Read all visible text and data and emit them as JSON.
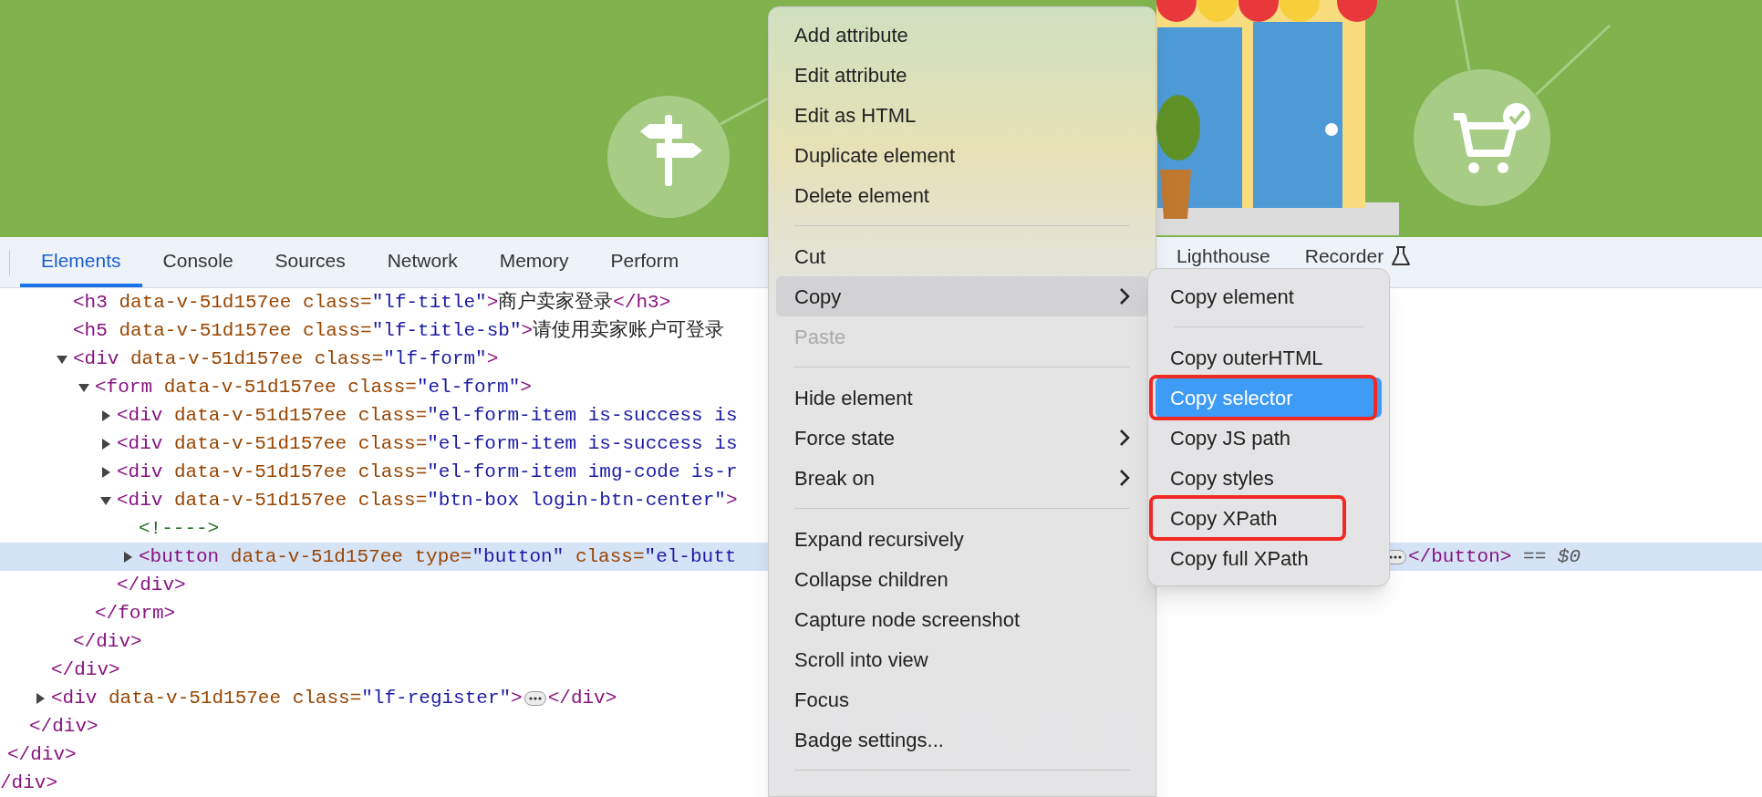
{
  "tabs": [
    {
      "label": "Elements",
      "selected": true
    },
    {
      "label": "Console",
      "selected": false
    },
    {
      "label": "Sources",
      "selected": false
    },
    {
      "label": "Network",
      "selected": false
    },
    {
      "label": "Memory",
      "selected": false
    },
    {
      "label": "Perform",
      "selected": false
    }
  ],
  "tabs_after_menu": [
    {
      "label": "Lighthouse",
      "experimental": false
    },
    {
      "label": "Recorder",
      "experimental": true
    }
  ],
  "dom_tree": [
    {
      "close": [
        {
          "kind": "tag",
          "text": "/div>"
        }
      ],
      "children": [
        {
          "close": [
            {
              "kind": "tag",
              "text": "</div>"
            }
          ],
          "children": [
            {
              "close": [
                {
                  "kind": "tag",
                  "text": "</div>"
                }
              ],
              "children": [
                {
                  "close": [
                    {
                      "kind": "tag",
                      "text": "</div>"
                    }
                  ],
                  "children": [
                    {
                      "selected": false,
                      "line": [
                        {
                          "kind": "tag",
                          "text": "<h3 "
                        },
                        {
                          "kind": "attr",
                          "text": "data-v-51d157ee class="
                        },
                        {
                          "kind": "value",
                          "text": "\"lf-title\""
                        },
                        {
                          "kind": "tag",
                          "text": ">"
                        },
                        {
                          "kind": "text",
                          "text": "商户卖家登录"
                        },
                        {
                          "kind": "tag",
                          "text": "</h3>"
                        }
                      ]
                    },
                    {
                      "selected": false,
                      "line": [
                        {
                          "kind": "tag",
                          "text": "<h5 "
                        },
                        {
                          "kind": "attr",
                          "text": "data-v-51d157ee class="
                        },
                        {
                          "kind": "value",
                          "text": "\"lf-title-sb\""
                        },
                        {
                          "kind": "tag",
                          "text": ">"
                        },
                        {
                          "kind": "text",
                          "text": "请使用卖家账户可登录"
                        }
                      ]
                    },
                    {
                      "selected": false,
                      "expanded": true,
                      "line": [
                        {
                          "kind": "tag",
                          "text": "<div "
                        },
                        {
                          "kind": "attr",
                          "text": "data-v-51d157ee class="
                        },
                        {
                          "kind": "value",
                          "text": "\"lf-form\""
                        },
                        {
                          "kind": "tag",
                          "text": ">"
                        }
                      ],
                      "close": [
                        {
                          "kind": "tag",
                          "text": "</div>"
                        }
                      ],
                      "children": [
                        {
                          "selected": false,
                          "expanded": true,
                          "line": [
                            {
                              "kind": "tag",
                              "text": "<form "
                            },
                            {
                              "kind": "attr",
                              "text": "data-v-51d157ee class="
                            },
                            {
                              "kind": "value",
                              "text": "\"el-form\""
                            },
                            {
                              "kind": "tag",
                              "text": ">"
                            }
                          ],
                          "close": [
                            {
                              "kind": "tag",
                              "text": "</form>"
                            }
                          ],
                          "children": [
                            {
                              "selected": false,
                              "expanded": false,
                              "line": [
                                {
                                  "kind": "tag",
                                  "text": "<div "
                                },
                                {
                                  "kind": "attr",
                                  "text": "data-v-51d157ee class="
                                },
                                {
                                  "kind": "value",
                                  "text": "\"el-form-item is-success is"
                                }
                              ]
                            },
                            {
                              "selected": false,
                              "expanded": false,
                              "line": [
                                {
                                  "kind": "tag",
                                  "text": "<div "
                                },
                                {
                                  "kind": "attr",
                                  "text": "data-v-51d157ee class="
                                },
                                {
                                  "kind": "value",
                                  "text": "\"el-form-item is-success is"
                                }
                              ]
                            },
                            {
                              "selected": false,
                              "expanded": false,
                              "line": [
                                {
                                  "kind": "tag",
                                  "text": "<div "
                                },
                                {
                                  "kind": "attr",
                                  "text": "data-v-51d157ee class="
                                },
                                {
                                  "kind": "value",
                                  "text": "\"el-form-item img-code is-r"
                                }
                              ]
                            },
                            {
                              "selected": false,
                              "expanded": true,
                              "line": [
                                {
                                  "kind": "tag",
                                  "text": "<div "
                                },
                                {
                                  "kind": "attr",
                                  "text": "data-v-51d157ee class="
                                },
                                {
                                  "kind": "value",
                                  "text": "\"btn-box login-btn-center\""
                                },
                                {
                                  "kind": "tag",
                                  "text": ">"
                                }
                              ],
                              "close": [
                                {
                                  "kind": "tag",
                                  "text": "</div>"
                                }
                              ],
                              "children": [
                                {
                                  "selected": false,
                                  "line": [
                                    {
                                      "kind": "comment",
                                      "text": "<!---->"
                                    }
                                  ]
                                },
                                {
                                  "selected": true,
                                  "expanded": false,
                                  "covered": true,
                                  "badge": true,
                                  "line": [
                                    {
                                      "kind": "tag",
                                      "text": "<button "
                                    },
                                    {
                                      "kind": "attr",
                                      "text": "data-v-51d157ee type="
                                    },
                                    {
                                      "kind": "value",
                                      "text": "\"button\""
                                    },
                                    {
                                      "kind": "attr",
                                      "text": " class="
                                    },
                                    {
                                      "kind": "value",
                                      "text": "\"el-butt"
                                    }
                                  ],
                                  "after": [
                                    {
                                      "kind": "tag",
                                      "text": "</button>"
                                    },
                                    {
                                      "kind": "ref",
                                      "text": " == "
                                    },
                                    {
                                      "kind": "var",
                                      "text": "$0"
                                    }
                                  ]
                                }
                              ]
                            }
                          ]
                        }
                      ]
                    }
                  ]
                },
                {
                  "selected": false,
                  "expanded": false,
                  "badge": true,
                  "line": [
                    {
                      "kind": "tag",
                      "text": "<div "
                    },
                    {
                      "kind": "attr",
                      "text": "data-v-51d157ee class="
                    },
                    {
                      "kind": "value",
                      "text": "\"lf-register\""
                    },
                    {
                      "kind": "tag",
                      "text": ">"
                    }
                  ],
                  "after": [
                    {
                      "kind": "tag",
                      "text": "</div>"
                    }
                  ]
                }
              ]
            }
          ]
        }
      ]
    }
  ],
  "context_menu": [
    {
      "kind": "item",
      "label": "Add attribute",
      "disabled": false,
      "highlighted": false,
      "submenu": false
    },
    {
      "kind": "item",
      "label": "Edit attribute",
      "disabled": false,
      "highlighted": false,
      "submenu": false
    },
    {
      "kind": "item",
      "label": "Edit as HTML",
      "disabled": false,
      "highlighted": false,
      "submenu": false
    },
    {
      "kind": "item",
      "label": "Duplicate element",
      "disabled": false,
      "highlighted": false,
      "submenu": false
    },
    {
      "kind": "item",
      "label": "Delete element",
      "disabled": false,
      "highlighted": false,
      "submenu": false
    },
    {
      "kind": "separator"
    },
    {
      "kind": "item",
      "label": "Cut",
      "disabled": false,
      "highlighted": false,
      "submenu": false
    },
    {
      "kind": "item",
      "label": "Copy",
      "disabled": false,
      "highlighted": true,
      "submenu": true
    },
    {
      "kind": "item",
      "label": "Paste",
      "disabled": true,
      "highlighted": false,
      "submenu": false
    },
    {
      "kind": "separator"
    },
    {
      "kind": "item",
      "label": "Hide element",
      "disabled": false,
      "highlighted": false,
      "submenu": false
    },
    {
      "kind": "item",
      "label": "Force state",
      "disabled": false,
      "highlighted": false,
      "submenu": true
    },
    {
      "kind": "item",
      "label": "Break on",
      "disabled": false,
      "highlighted": false,
      "submenu": true
    },
    {
      "kind": "separator"
    },
    {
      "kind": "item",
      "label": "Expand recursively",
      "disabled": false,
      "highlighted": false,
      "submenu": false
    },
    {
      "kind": "item",
      "label": "Collapse children",
      "disabled": false,
      "highlighted": false,
      "submenu": false
    },
    {
      "kind": "item",
      "label": "Capture node screenshot",
      "disabled": false,
      "highlighted": false,
      "submenu": false
    },
    {
      "kind": "item",
      "label": "Scroll into view",
      "disabled": false,
      "highlighted": false,
      "submenu": false
    },
    {
      "kind": "item",
      "label": "Focus",
      "disabled": false,
      "highlighted": false,
      "submenu": false
    },
    {
      "kind": "item",
      "label": "Badge settings...",
      "disabled": false,
      "highlighted": false,
      "submenu": false
    },
    {
      "kind": "separator"
    }
  ],
  "copy_submenu": [
    {
      "kind": "item",
      "label": "Copy element",
      "selected": false,
      "annotated": false
    },
    {
      "kind": "separator"
    },
    {
      "kind": "item",
      "label": "Copy outerHTML",
      "selected": false,
      "annotated": false
    },
    {
      "kind": "item",
      "label": "Copy selector",
      "selected": true,
      "annotated": true
    },
    {
      "kind": "item",
      "label": "Copy JS path",
      "selected": false,
      "annotated": false
    },
    {
      "kind": "item",
      "label": "Copy styles",
      "selected": false,
      "annotated": false
    },
    {
      "kind": "item",
      "label": "Copy XPath",
      "selected": false,
      "annotated": true
    },
    {
      "kind": "item",
      "label": "Copy full XPath",
      "selected": false,
      "annotated": false
    }
  ]
}
